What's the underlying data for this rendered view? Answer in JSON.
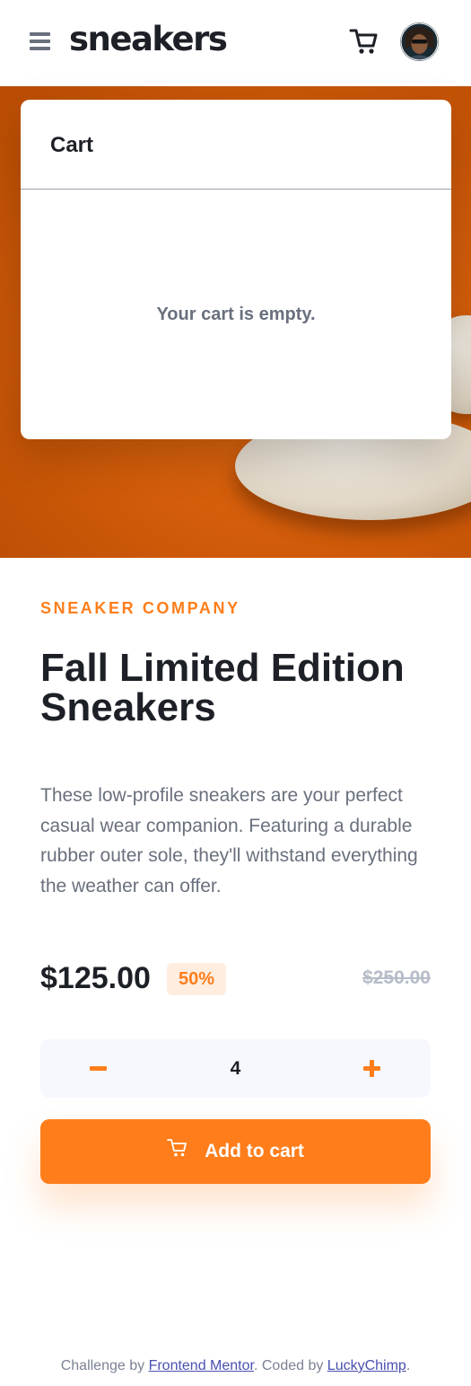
{
  "header": {
    "menu_icon": "hamburger-menu-icon",
    "logo": "sneakers",
    "cart_icon": "cart-icon",
    "avatar_alt": "user avatar"
  },
  "cart": {
    "title": "Cart",
    "empty_message": "Your cart is empty."
  },
  "product": {
    "company": "SNEAKER COMPANY",
    "title": "Fall Limited Edition Sneakers",
    "description": "These low-profile sneakers are your perfect casual wear companion. Featuring a durable rubber outer sole, they'll withstand everything the weather can offer.",
    "price": "$125.00",
    "discount": "50%",
    "original_price": "$250.00"
  },
  "quantity": {
    "value": "4",
    "minus_icon": "minus-icon",
    "plus_icon": "plus-icon"
  },
  "add_to_cart": {
    "label": "Add to cart",
    "icon": "cart-icon"
  },
  "footer": {
    "prefix": "Challenge by ",
    "mentor_link": "Frontend Mentor",
    "middle": ". Coded by ",
    "author_link": "LuckyChimp",
    "suffix": "."
  },
  "colors": {
    "accent": "#ff7e1b",
    "accent_pale": "#ffede0",
    "text_dark": "#1d2026",
    "text_gray": "#69707d",
    "hero_orange": "#d35d0a"
  }
}
